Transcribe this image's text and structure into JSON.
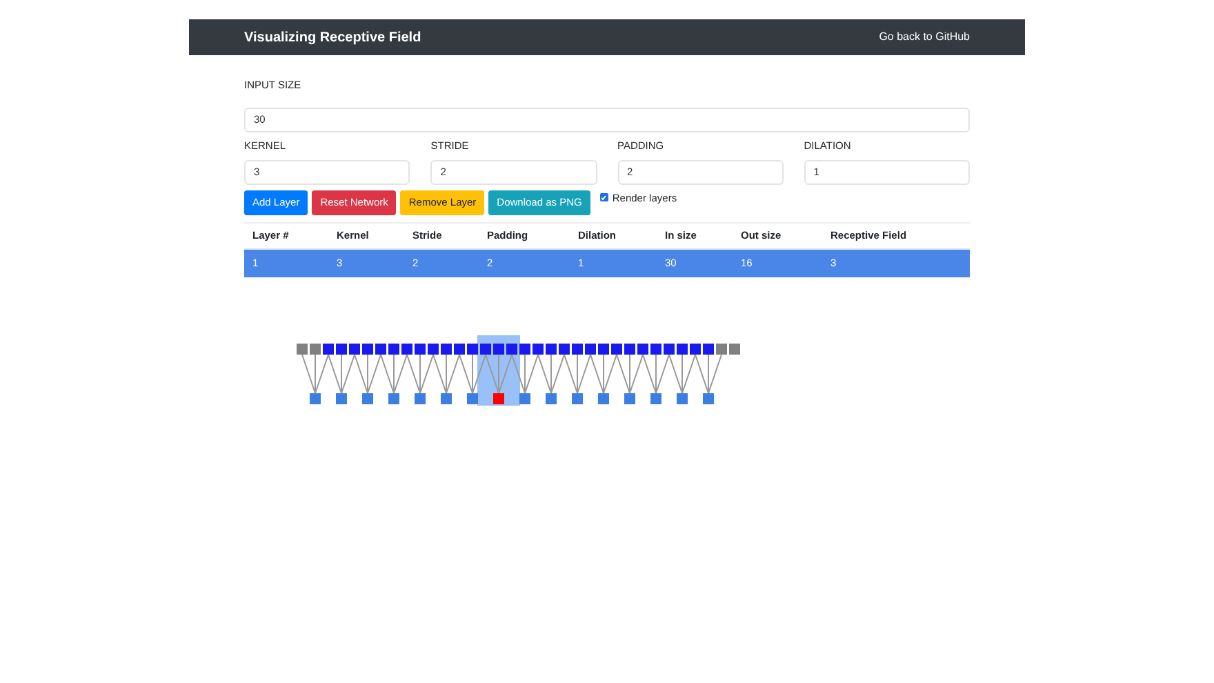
{
  "navbar": {
    "title": "Visualizing Receptive Field",
    "link": "Go back to GitHub"
  },
  "input_size": {
    "label": "INPUT SIZE",
    "value": "30"
  },
  "fields": [
    {
      "label": "KERNEL",
      "value": "3"
    },
    {
      "label": "STRIDE",
      "value": "2"
    },
    {
      "label": "PADDING",
      "value": "2"
    },
    {
      "label": "DILATION",
      "value": "1"
    }
  ],
  "buttons": [
    {
      "label": "Add Layer",
      "kind": "primary"
    },
    {
      "label": "Reset Network",
      "kind": "danger"
    },
    {
      "label": "Remove Layer",
      "kind": "warning"
    },
    {
      "label": "Download as PNG",
      "kind": "info"
    }
  ],
  "render_layers": {
    "label": "Render layers",
    "checked": true
  },
  "table": {
    "columns": [
      "Layer #",
      "Kernel",
      "Stride",
      "Padding",
      "Dilation",
      "In size",
      "Out size",
      "Receptive Field"
    ],
    "rows": [
      {
        "selected": true,
        "cells": [
          "1",
          "3",
          "2",
          "2",
          "1",
          "30",
          "16",
          "3"
        ]
      }
    ]
  },
  "diagram": {
    "output_nodes": [
      {
        "selected": false
      },
      {
        "selected": false
      },
      {
        "selected": false
      },
      {
        "selected": false
      },
      {
        "selected": false
      },
      {
        "selected": false
      },
      {
        "selected": false
      },
      {
        "selected": true
      },
      {
        "selected": false
      },
      {
        "selected": false
      },
      {
        "selected": false
      },
      {
        "selected": false
      },
      {
        "selected": false
      },
      {
        "selected": false
      },
      {
        "selected": false
      },
      {
        "selected": false
      }
    ]
  }
}
